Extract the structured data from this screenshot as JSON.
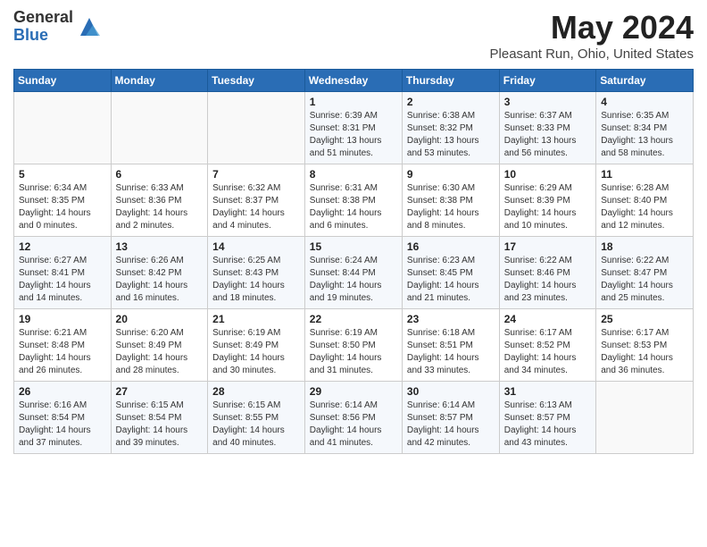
{
  "header": {
    "logo_general": "General",
    "logo_blue": "Blue",
    "month_year": "May 2024",
    "location": "Pleasant Run, Ohio, United States"
  },
  "days_of_week": [
    "Sunday",
    "Monday",
    "Tuesday",
    "Wednesday",
    "Thursday",
    "Friday",
    "Saturday"
  ],
  "weeks": [
    [
      {
        "date": "",
        "info": ""
      },
      {
        "date": "",
        "info": ""
      },
      {
        "date": "",
        "info": ""
      },
      {
        "date": "1",
        "info": "Sunrise: 6:39 AM\nSunset: 8:31 PM\nDaylight: 13 hours and 51 minutes."
      },
      {
        "date": "2",
        "info": "Sunrise: 6:38 AM\nSunset: 8:32 PM\nDaylight: 13 hours and 53 minutes."
      },
      {
        "date": "3",
        "info": "Sunrise: 6:37 AM\nSunset: 8:33 PM\nDaylight: 13 hours and 56 minutes."
      },
      {
        "date": "4",
        "info": "Sunrise: 6:35 AM\nSunset: 8:34 PM\nDaylight: 13 hours and 58 minutes."
      }
    ],
    [
      {
        "date": "5",
        "info": "Sunrise: 6:34 AM\nSunset: 8:35 PM\nDaylight: 14 hours and 0 minutes."
      },
      {
        "date": "6",
        "info": "Sunrise: 6:33 AM\nSunset: 8:36 PM\nDaylight: 14 hours and 2 minutes."
      },
      {
        "date": "7",
        "info": "Sunrise: 6:32 AM\nSunset: 8:37 PM\nDaylight: 14 hours and 4 minutes."
      },
      {
        "date": "8",
        "info": "Sunrise: 6:31 AM\nSunset: 8:38 PM\nDaylight: 14 hours and 6 minutes."
      },
      {
        "date": "9",
        "info": "Sunrise: 6:30 AM\nSunset: 8:38 PM\nDaylight: 14 hours and 8 minutes."
      },
      {
        "date": "10",
        "info": "Sunrise: 6:29 AM\nSunset: 8:39 PM\nDaylight: 14 hours and 10 minutes."
      },
      {
        "date": "11",
        "info": "Sunrise: 6:28 AM\nSunset: 8:40 PM\nDaylight: 14 hours and 12 minutes."
      }
    ],
    [
      {
        "date": "12",
        "info": "Sunrise: 6:27 AM\nSunset: 8:41 PM\nDaylight: 14 hours and 14 minutes."
      },
      {
        "date": "13",
        "info": "Sunrise: 6:26 AM\nSunset: 8:42 PM\nDaylight: 14 hours and 16 minutes."
      },
      {
        "date": "14",
        "info": "Sunrise: 6:25 AM\nSunset: 8:43 PM\nDaylight: 14 hours and 18 minutes."
      },
      {
        "date": "15",
        "info": "Sunrise: 6:24 AM\nSunset: 8:44 PM\nDaylight: 14 hours and 19 minutes."
      },
      {
        "date": "16",
        "info": "Sunrise: 6:23 AM\nSunset: 8:45 PM\nDaylight: 14 hours and 21 minutes."
      },
      {
        "date": "17",
        "info": "Sunrise: 6:22 AM\nSunset: 8:46 PM\nDaylight: 14 hours and 23 minutes."
      },
      {
        "date": "18",
        "info": "Sunrise: 6:22 AM\nSunset: 8:47 PM\nDaylight: 14 hours and 25 minutes."
      }
    ],
    [
      {
        "date": "19",
        "info": "Sunrise: 6:21 AM\nSunset: 8:48 PM\nDaylight: 14 hours and 26 minutes."
      },
      {
        "date": "20",
        "info": "Sunrise: 6:20 AM\nSunset: 8:49 PM\nDaylight: 14 hours and 28 minutes."
      },
      {
        "date": "21",
        "info": "Sunrise: 6:19 AM\nSunset: 8:49 PM\nDaylight: 14 hours and 30 minutes."
      },
      {
        "date": "22",
        "info": "Sunrise: 6:19 AM\nSunset: 8:50 PM\nDaylight: 14 hours and 31 minutes."
      },
      {
        "date": "23",
        "info": "Sunrise: 6:18 AM\nSunset: 8:51 PM\nDaylight: 14 hours and 33 minutes."
      },
      {
        "date": "24",
        "info": "Sunrise: 6:17 AM\nSunset: 8:52 PM\nDaylight: 14 hours and 34 minutes."
      },
      {
        "date": "25",
        "info": "Sunrise: 6:17 AM\nSunset: 8:53 PM\nDaylight: 14 hours and 36 minutes."
      }
    ],
    [
      {
        "date": "26",
        "info": "Sunrise: 6:16 AM\nSunset: 8:54 PM\nDaylight: 14 hours and 37 minutes."
      },
      {
        "date": "27",
        "info": "Sunrise: 6:15 AM\nSunset: 8:54 PM\nDaylight: 14 hours and 39 minutes."
      },
      {
        "date": "28",
        "info": "Sunrise: 6:15 AM\nSunset: 8:55 PM\nDaylight: 14 hours and 40 minutes."
      },
      {
        "date": "29",
        "info": "Sunrise: 6:14 AM\nSunset: 8:56 PM\nDaylight: 14 hours and 41 minutes."
      },
      {
        "date": "30",
        "info": "Sunrise: 6:14 AM\nSunset: 8:57 PM\nDaylight: 14 hours and 42 minutes."
      },
      {
        "date": "31",
        "info": "Sunrise: 6:13 AM\nSunset: 8:57 PM\nDaylight: 14 hours and 43 minutes."
      },
      {
        "date": "",
        "info": ""
      }
    ]
  ]
}
